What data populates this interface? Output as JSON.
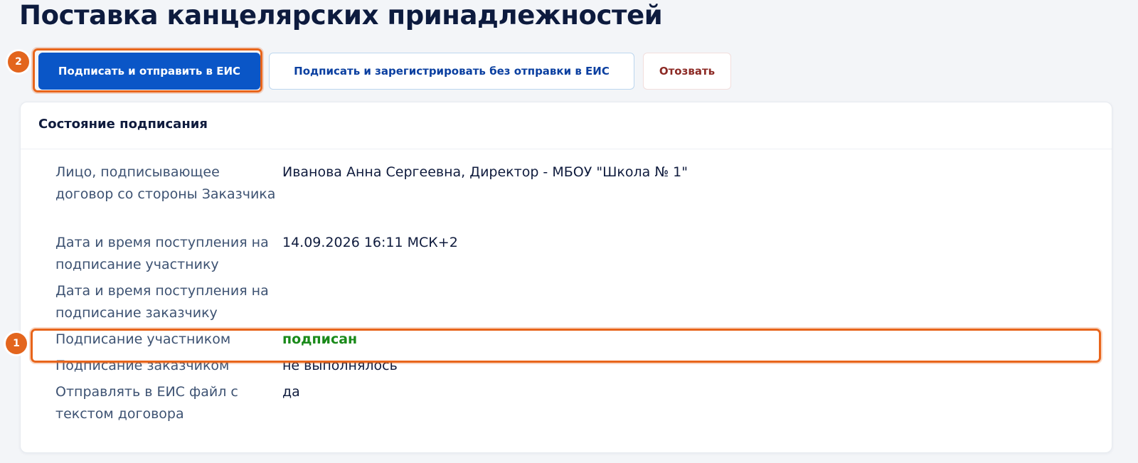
{
  "page": {
    "title": "Поставка канцелярских принадлежностей"
  },
  "toolbar": {
    "sign_send_label": "Подписать и отправить в ЕИС",
    "sign_register_label": "Подписать и зарегистрировать без отправки в ЕИС",
    "revoke_label": "Отозвать"
  },
  "markers": {
    "one": "1",
    "two": "2"
  },
  "colors": {
    "accent": "#0a56c7",
    "highlight": "#e8651b",
    "success": "#1a8a1a",
    "danger": "#8c2a25"
  },
  "signing_status": {
    "title": "Состояние подписания",
    "rows": [
      {
        "label": "Лицо, подписывающее договор со стороны Заказчика",
        "value": "Иванова Анна Сергеевна, Директор - МБОУ \"Школа № 1\""
      },
      {
        "label": "Дата и время поступления на подписание участнику",
        "value": "14.09.2026 16:11 МСК+2"
      },
      {
        "label": "Дата и время поступления на подписание заказчику",
        "value": ""
      },
      {
        "label": "Подписание участником",
        "value": "подписан"
      },
      {
        "label": "Подписание заказчиком",
        "value": "не выполнялось"
      },
      {
        "label": "Отправлять в ЕИС файл с текстом договора",
        "value": "да"
      }
    ]
  }
}
